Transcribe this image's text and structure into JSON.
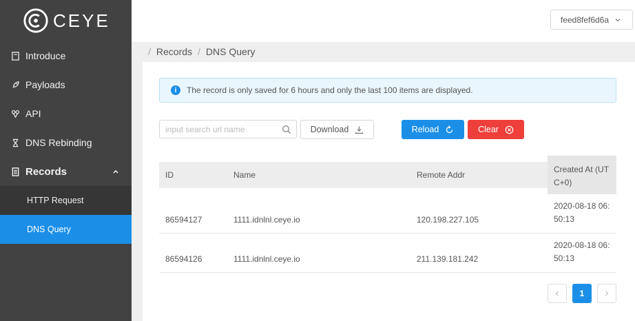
{
  "app": {
    "logo_text": "CEYE"
  },
  "colors": {
    "sidebar": "#424242",
    "accent": "#1b8fe8",
    "danger": "#ee3f3b",
    "active_item": "#1b8fe8"
  },
  "sidebar": {
    "items": [
      {
        "label": "Introduce",
        "icon": "book-icon"
      },
      {
        "label": "Payloads",
        "icon": "rocket-icon"
      },
      {
        "label": "API",
        "icon": "api-icon"
      },
      {
        "label": "DNS Rebinding",
        "icon": "hourglass-icon"
      },
      {
        "label": "Records",
        "icon": "list-icon",
        "expanded": true
      }
    ],
    "subitems": [
      {
        "label": "HTTP Request"
      },
      {
        "label": "DNS Query",
        "active": true
      }
    ]
  },
  "header": {
    "account": "feed8fef6d6a"
  },
  "breadcrumb": [
    "Records",
    "DNS Query"
  ],
  "alert": {
    "text": "The record is only saved for 6 hours and only the last 100 items are displayed."
  },
  "toolbar": {
    "search_placeholder": "input search url name",
    "search_value": "",
    "download_label": "Download",
    "reload_label": "Reload",
    "clear_label": "Clear"
  },
  "table": {
    "columns": [
      "ID",
      "Name",
      "Remote Addr",
      "Created At (UTC+0)"
    ],
    "created_header_lines": [
      "Created At (UT",
      "C+0)"
    ],
    "rows": [
      {
        "id": "86594127",
        "name": "1111.idnlnl.ceye.io",
        "remote_addr": "120.198.227.105",
        "created_lines": [
          "2020-08-18 06:",
          "50:13"
        ]
      },
      {
        "id": "86594126",
        "name": "1111.idnlnl.ceye.io",
        "remote_addr": "211.139.181.242",
        "created_lines": [
          "2020-08-18 06:",
          "50:13"
        ]
      }
    ]
  },
  "pagination": {
    "current": "1",
    "prev": "<",
    "next": ">"
  }
}
